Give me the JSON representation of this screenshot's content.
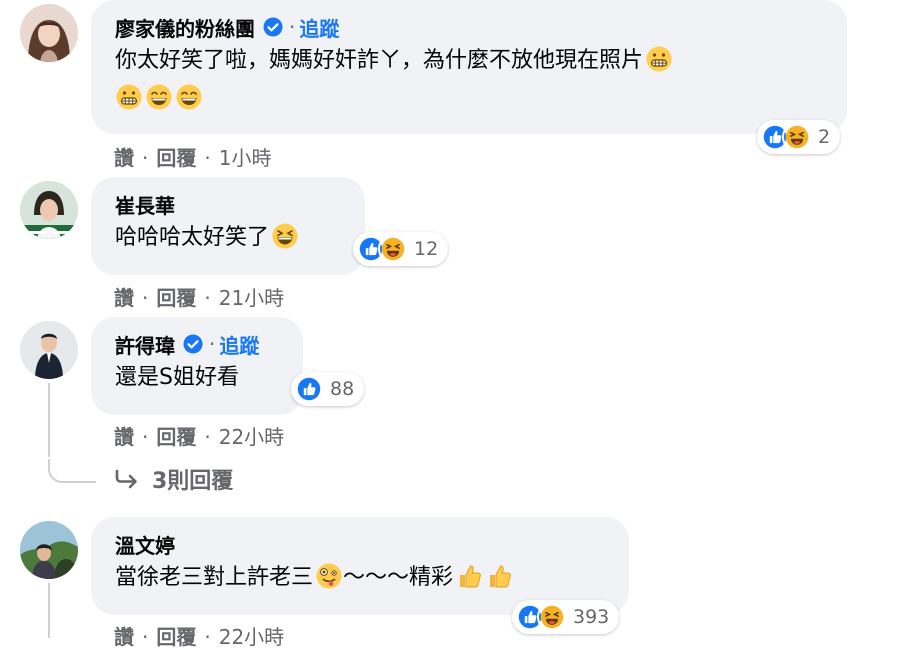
{
  "comments": [
    {
      "name": "廖家儀的粉絲團",
      "verified": true,
      "follow_label": "追蹤",
      "text": "你太好笑了啦，媽媽好奸詐ㄚ，為什麼不放他現在照片",
      "reactions": [
        "like",
        "haha"
      ],
      "reaction_count": "2",
      "actions": {
        "like": "讚",
        "reply": "回覆",
        "time": "1小時"
      }
    },
    {
      "name": "崔長華",
      "verified": false,
      "text": "哈哈哈太好笑了",
      "reactions": [
        "like",
        "haha"
      ],
      "reaction_count": "12",
      "actions": {
        "like": "讚",
        "reply": "回覆",
        "time": "21小時"
      }
    },
    {
      "name": "許得瑋",
      "verified": true,
      "follow_label": "追蹤",
      "text": "還是S姐好看",
      "reactions": [
        "like"
      ],
      "reaction_count": "88",
      "actions": {
        "like": "讚",
        "reply": "回覆",
        "time": "22小時"
      }
    },
    {
      "name": "溫文婷",
      "verified": false,
      "text": "當徐老三對上許老三",
      "text_after_emoji": "～～～精彩",
      "reactions": [
        "like",
        "haha"
      ],
      "reaction_count": "393",
      "actions": {
        "like": "讚",
        "reply": "回覆",
        "time": "22小時"
      }
    }
  ],
  "replies_link": "3則回覆",
  "separator": "·",
  "colors": {
    "bubble": "#f0f2f5",
    "link_blue": "#1877f2",
    "meta_gray": "#65676b",
    "like_blue": "#1877f2",
    "haha_yellow": "#f7b125"
  }
}
